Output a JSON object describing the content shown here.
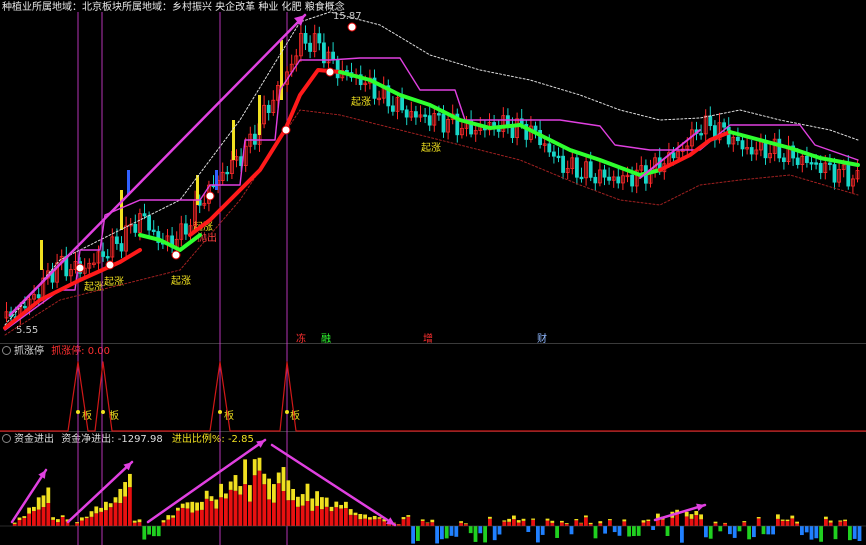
{
  "header": {
    "concepts": "种植业所属地域：北京板块所属地域：乡村振兴 央企改革 种业 化肥 粮食概念"
  },
  "main": {
    "price_high": "15.87",
    "price_low": "5.55",
    "signal_label": "起涨",
    "sell_label": "抛出",
    "markers": [
      "冻",
      "融",
      "增",
      "财"
    ]
  },
  "indicator1": {
    "name": "抓涨停",
    "field": "抓涨停: 0.00",
    "tag": "板"
  },
  "indicator2": {
    "name": "资金进出",
    "net_label": "资金净进出: -1297.98",
    "ratio_label": "进出比例%: -2.85"
  },
  "colors": {
    "bg": "#000000",
    "up": "#ff2a2a",
    "down": "#19d6c8",
    "ma_red": "#ff1a1a",
    "ma_green": "#2eff2e",
    "magenta": "#e040e0",
    "yellow": "#f0e020",
    "white_dotted": "#dddddd"
  }
}
